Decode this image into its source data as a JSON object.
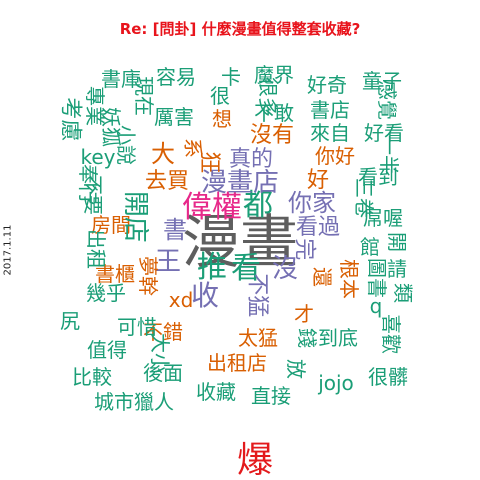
{
  "title": "Re: [問卦] 什麼漫畫值得整套收藏?",
  "date": "2017.1.11",
  "colors": {
    "title": "#e8141c",
    "gray": "#5e5e5e",
    "teal": "#1b9e77",
    "orange": "#d95f02",
    "purple": "#7570b3",
    "magenta": "#e7298a",
    "red": "#e31a1c"
  },
  "words": [
    {
      "text": "漫畫",
      "color": "gray"
    },
    {
      "text": "偉權",
      "color": "magenta"
    },
    {
      "text": "都",
      "color": "teal"
    },
    {
      "text": "推",
      "color": "teal"
    },
    {
      "text": "看",
      "color": "teal"
    },
    {
      "text": "王",
      "color": "purple"
    },
    {
      "text": "收",
      "color": "purple"
    },
    {
      "text": "漫畫店",
      "color": "purple"
    },
    {
      "text": "書",
      "color": "purple"
    },
    {
      "text": "你家",
      "color": "purple"
    },
    {
      "text": "沒",
      "color": "purple"
    },
    {
      "text": "看過",
      "color": "purple"
    },
    {
      "text": "完",
      "color": "purple"
    },
    {
      "text": "不猛",
      "color": "purple"
    },
    {
      "text": "真的",
      "color": "purple"
    },
    {
      "text": "好",
      "color": "orange"
    },
    {
      "text": "你好",
      "color": "orange"
    },
    {
      "text": "沒有",
      "color": "orange"
    },
    {
      "text": "大",
      "color": "orange"
    },
    {
      "text": "去買",
      "color": "orange"
    },
    {
      "text": "房間",
      "color": "orange"
    },
    {
      "text": "書櫃",
      "color": "orange"
    },
    {
      "text": "夢幹",
      "color": "orange"
    },
    {
      "text": "xd",
      "color": "orange"
    },
    {
      "text": "不錯",
      "color": "orange"
    },
    {
      "text": "出租店",
      "color": "orange"
    },
    {
      "text": "太猛",
      "color": "orange"
    },
    {
      "text": "才",
      "color": "orange"
    },
    {
      "text": "還",
      "color": "orange"
    },
    {
      "text": "根本",
      "color": "orange"
    },
    {
      "text": "狂",
      "color": "orange"
    },
    {
      "text": "想",
      "color": "orange"
    },
    {
      "text": "系",
      "color": "orange"
    },
    {
      "text": "爆",
      "color": "red"
    },
    {
      "text": "書庫",
      "color": "teal"
    },
    {
      "text": "容易",
      "color": "teal"
    },
    {
      "text": "卡",
      "color": "teal"
    },
    {
      "text": "魔界",
      "color": "teal"
    },
    {
      "text": "好奇",
      "color": "teal"
    },
    {
      "text": "童子",
      "color": "teal"
    },
    {
      "text": "考慮",
      "color": "teal"
    },
    {
      "text": "專業",
      "color": "teal"
    },
    {
      "text": "現在",
      "color": "teal"
    },
    {
      "text": "很",
      "color": "teal"
    },
    {
      "text": "很多",
      "color": "teal"
    },
    {
      "text": "書店",
      "color": "teal"
    },
    {
      "text": "感覺",
      "color": "teal"
    },
    {
      "text": "妖狐",
      "color": "teal"
    },
    {
      "text": "小說",
      "color": "teal"
    },
    {
      "text": "厲害",
      "color": "teal"
    },
    {
      "text": "不敢",
      "color": "teal"
    },
    {
      "text": "來自",
      "color": "teal"
    },
    {
      "text": "好看",
      "color": "teal"
    },
    {
      "text": "key",
      "color": "teal"
    },
    {
      "text": "一半",
      "color": "teal"
    },
    {
      "text": "奉行",
      "color": "teal"
    },
    {
      "text": "看到",
      "color": "teal"
    },
    {
      "text": "不要",
      "color": "teal"
    },
    {
      "text": "三卷",
      "color": "teal"
    },
    {
      "text": "開店",
      "color": "teal"
    },
    {
      "text": "屌喔",
      "color": "teal"
    },
    {
      "text": "出租",
      "color": "teal"
    },
    {
      "text": "館",
      "color": "teal"
    },
    {
      "text": "開",
      "color": "teal"
    },
    {
      "text": "圖書",
      "color": "teal"
    },
    {
      "text": "請",
      "color": "teal"
    },
    {
      "text": "幾乎",
      "color": "teal"
    },
    {
      "text": "q",
      "color": "teal"
    },
    {
      "text": "類",
      "color": "teal"
    },
    {
      "text": "尻",
      "color": "teal"
    },
    {
      "text": "可惜",
      "color": "teal"
    },
    {
      "text": "喜歡",
      "color": "teal"
    },
    {
      "text": "值得",
      "color": "teal"
    },
    {
      "text": "大小",
      "color": "teal"
    },
    {
      "text": "到底",
      "color": "teal"
    },
    {
      "text": "比較",
      "color": "teal"
    },
    {
      "text": "後面",
      "color": "teal"
    },
    {
      "text": "放",
      "color": "teal"
    },
    {
      "text": "錢",
      "color": "teal"
    },
    {
      "text": "jojo",
      "color": "teal"
    },
    {
      "text": "很髒",
      "color": "teal"
    },
    {
      "text": "城市獵人",
      "color": "teal"
    },
    {
      "text": "收藏",
      "color": "teal"
    },
    {
      "text": "直接",
      "color": "teal"
    }
  ]
}
